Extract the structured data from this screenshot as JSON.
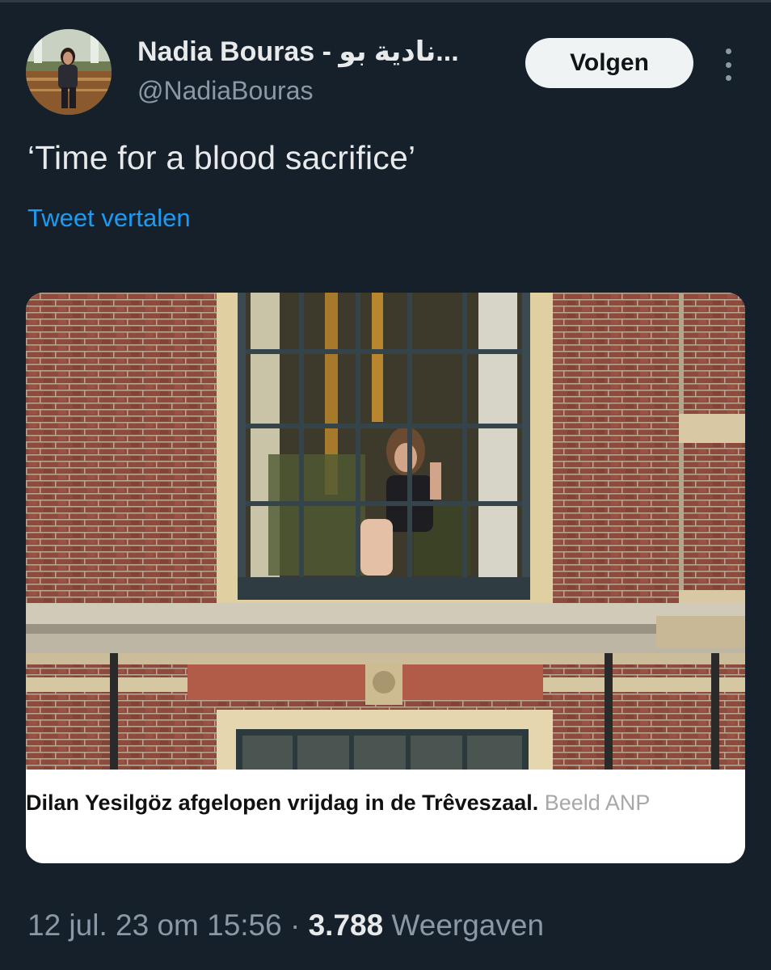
{
  "tweet": {
    "author_name": "Nadia Bouras - نادية بو...",
    "handle": "@NadiaBouras",
    "follow_label": "Volgen",
    "text": "‘Time for a blood sacrifice’",
    "translate_label": "Tweet vertalen",
    "timestamp": "12 jul. 23 om 15:56",
    "separator": "·",
    "view_count": "3.788",
    "view_label": "Weergaven"
  },
  "card": {
    "caption_bold": "Dilan Yesilgöz afgelopen vrijdag in de Trêveszaal.",
    "caption_credit": "Beeld ANP"
  },
  "colors": {
    "background": "#15202b",
    "link": "#1d9bf0",
    "muted": "#8b98a5",
    "follow_bg": "#eff3f4"
  },
  "icons": {
    "more": "more-vertical-icon"
  }
}
